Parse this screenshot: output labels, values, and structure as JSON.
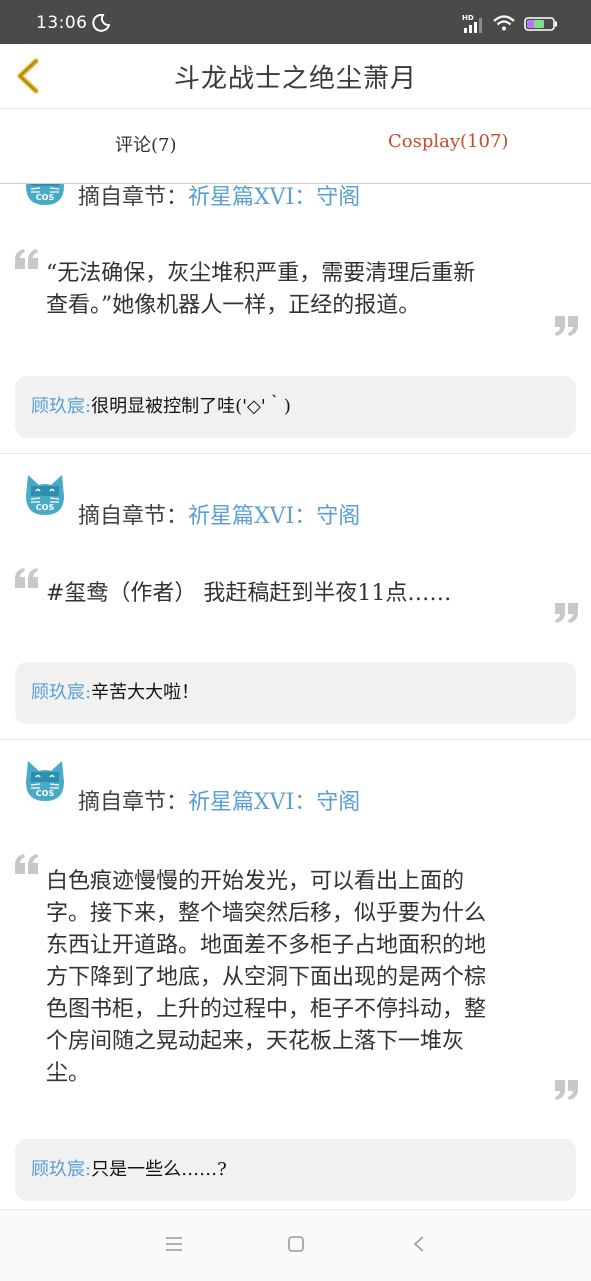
{
  "status_bar": {
    "time": "13:06",
    "network": "HD",
    "icons": [
      "moon-icon",
      "signal-icon",
      "wifi-icon",
      "battery-icon"
    ]
  },
  "header": {
    "title": "斗龙战士之绝尘萧月",
    "back_icon": "chevron-left-icon"
  },
  "tabs": [
    {
      "label": "评论(7)"
    },
    {
      "label": "Cosplay(107)"
    }
  ],
  "colors": {
    "accent_blue": "#5aa0d4",
    "active_tab": "#c84a2b",
    "back_icon": "#e3b21c",
    "avatar": "#49aac8"
  },
  "cards": [
    {
      "chapter_prefix": "摘自章节：",
      "chapter_link": "祈星篇XVI：守阁",
      "quote_lines": [
        "“无法确保，灰尘堆积严重，需要清理后重新",
        "查看。”她像机器人一样，正经的报道。"
      ],
      "reply": {
        "author": "顾玖宸:",
        "text": "很明显被控制了哇('◇'｀)"
      }
    },
    {
      "chapter_prefix": "摘自章节：",
      "chapter_link": "祈星篇XVI：守阁",
      "quote_lines": [
        "#玺鸯（作者） 我赶稿赶到半夜11点……"
      ],
      "reply": {
        "author": "顾玖宸:",
        "text": "辛苦大大啦！"
      }
    },
    {
      "chapter_prefix": "摘自章节：",
      "chapter_link": "祈星篇XVI：守阁",
      "quote_lines": [
        "白色痕迹慢慢的开始发光，可以看出上面的",
        "字。接下来，整个墙突然后移，似乎要为什么",
        "东西让开道路。地面差不多柜子占地面积的地",
        "方下降到了地底，从空洞下面出现的是两个棕",
        "色图书柜，上升的过程中，柜子不停抖动，整",
        "个房间随之晃动起来，天花板上落下一堆灰",
        "尘。"
      ],
      "reply": {
        "author": "顾玖宸:",
        "text": "只是一些么……?"
      }
    }
  ],
  "nav_bar": {
    "icons": [
      "menu-icon",
      "home-icon",
      "back-icon"
    ]
  }
}
